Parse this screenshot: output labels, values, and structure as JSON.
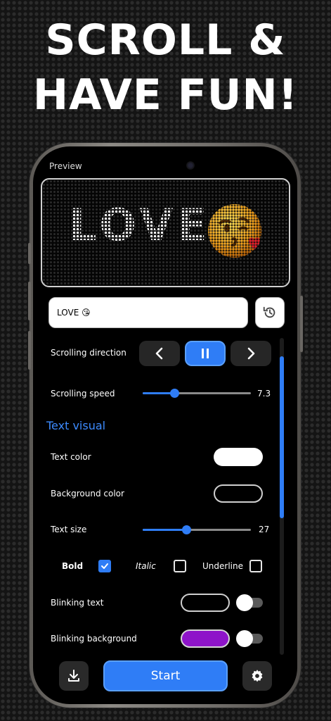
{
  "headline": {
    "line1": "SCROLL &",
    "line2": "HAVE FUN!"
  },
  "preview": {
    "label": "Preview",
    "led_text": "LOVE",
    "led_emoji_icon": "kissing-face-emoji-icon"
  },
  "text_input": {
    "value": "LOVE 😘"
  },
  "history_icon": "history-icon",
  "scrolling_direction": {
    "label": "Scrolling direction",
    "options": [
      "left",
      "pause",
      "right"
    ],
    "selected": "pause"
  },
  "scrolling_speed": {
    "label": "Scrolling speed",
    "value": "7.3",
    "fill_fraction": 0.29
  },
  "text_visual": {
    "title": "Text visual",
    "text_color": {
      "label": "Text color",
      "color": "#ffffff"
    },
    "background_color": {
      "label": "Background color",
      "color": "transparent"
    },
    "text_size": {
      "label": "Text size",
      "value": "27",
      "fill_fraction": 0.4
    },
    "styles": {
      "bold": {
        "label": "Bold",
        "checked": true
      },
      "italic": {
        "label": "Italic",
        "checked": false
      },
      "underline": {
        "label": "Underline",
        "checked": false
      }
    },
    "blinking_text": {
      "label": "Blinking text",
      "color": "transparent",
      "enabled": false
    },
    "blinking_background": {
      "label": "Blinking background",
      "color": "#8e14c9",
      "enabled": false
    }
  },
  "bottom_bar": {
    "download_icon": "download-icon",
    "start_label": "Start",
    "settings_icon": "gear-icon"
  },
  "accent_color": "#2f7df6"
}
